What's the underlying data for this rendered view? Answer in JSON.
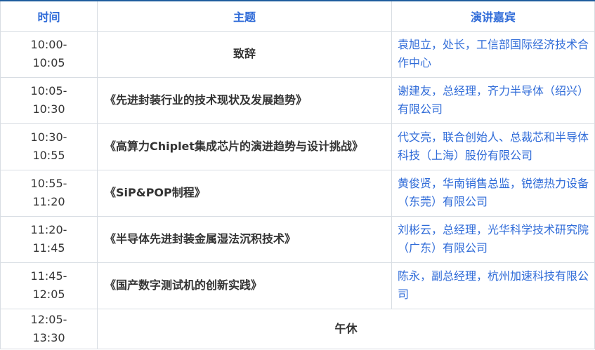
{
  "headers": {
    "time": "时间",
    "topic": "主题",
    "speaker": "演讲嘉宾"
  },
  "rows": [
    {
      "time": "10:00-\n10:05",
      "topic": "致辞",
      "speaker": "袁旭立，处长，工信部国际经济技术合作中心"
    },
    {
      "time": "10:05-\n10:30",
      "topic": "《先进封装行业的技术现状及发展趋势》",
      "speaker": "谢建友，总经理，齐力半导体（绍兴）有限公司"
    },
    {
      "time": "10:30-\n10:55",
      "topic": "《高算力Chiplet集成芯片的演进趋势与设计挑战》",
      "speaker": "代文亮，联合创始人、总裁芯和半导体科技（上海）股份有限公司"
    },
    {
      "time": "10:55-\n11:20",
      "topic": "《SiP&POP制程》",
      "speaker": "黄俊贤，华南销售总监，锐德热力设备（东莞）有限公司"
    },
    {
      "time": "11:20-\n11:45",
      "topic": "《半导体先进封装金属湿法沉积技术》",
      "speaker": "刘彬云，总经理，光华科学技术研究院（广东）有限公司"
    },
    {
      "time": "11:45-\n12:05",
      "topic": "《国产数字测试机的创新实践》",
      "speaker": "陈永，副总经理，杭州加速科技有限公司"
    },
    {
      "time": "12:05-\n13:30",
      "topic": "午休",
      "speaker": ""
    }
  ],
  "colors": {
    "header_text": "#2f6bd8",
    "speaker_text": "#2f6bd8",
    "body_text": "#333333",
    "top_border": "#1f5d9e",
    "grid": "#d8dde3"
  }
}
